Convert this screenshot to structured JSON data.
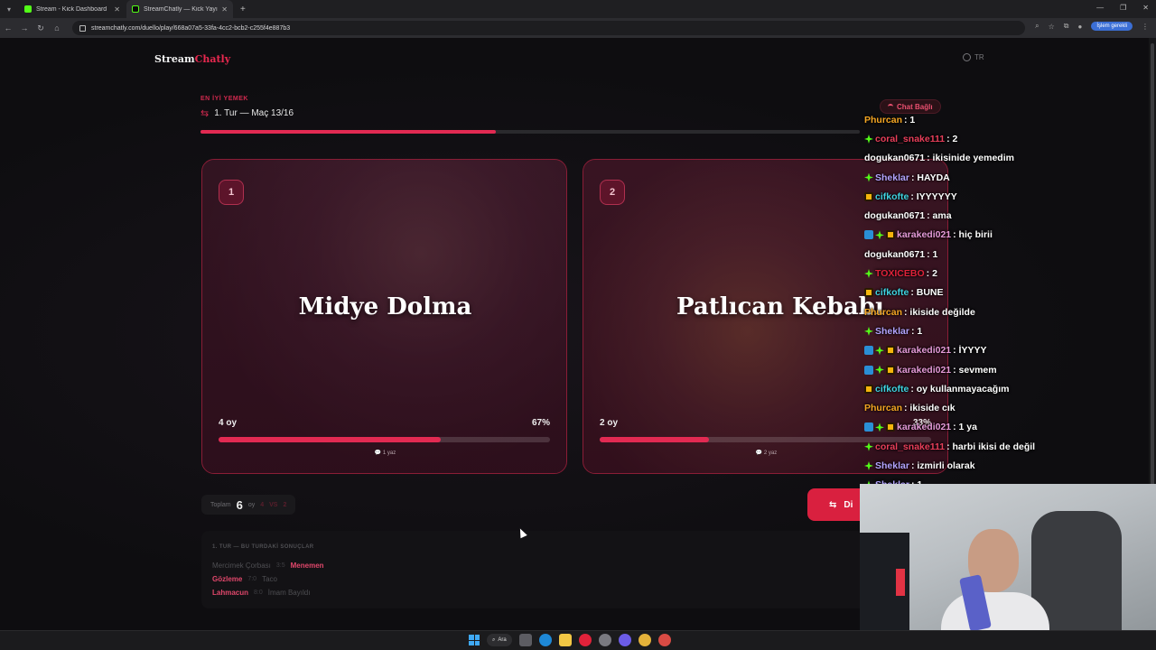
{
  "browser": {
    "tabs": [
      {
        "title": "Stream - Kick Dashboard",
        "active": false
      },
      {
        "title": "StreamChatly — Kick Yayıncıla",
        "active": true
      }
    ],
    "url": "streamchatly.com/duello/play/668a07a5-33fa-4cc2-bcb2-c255f4e887b3",
    "profile_label": "İşlem gerekli"
  },
  "app": {
    "logo_main": "Stream",
    "logo_accent": "Chatly",
    "lang": "TR"
  },
  "duel": {
    "category": "EN İYİ YEMEK",
    "round_label": "1. Tur — Maç 13/16",
    "progress": 0.448,
    "option1": {
      "badge": "1",
      "name": "Midye Dolma",
      "votes": "4 oy",
      "percent": "67%",
      "fill": 0.67,
      "hint": "1 yaz"
    },
    "option2": {
      "badge": "2",
      "name": "Patlıcan Kebabı",
      "votes": "2 oy",
      "percent": "33%",
      "fill": 0.33,
      "hint": "2 yaz"
    },
    "total_label": "Toplam",
    "total_votes": "6",
    "total_unit": "oy",
    "score_left": "4",
    "vs_label": "VS",
    "score_right": "2",
    "next_label": "Di"
  },
  "results": {
    "heading": "1. TUR — BU TURDAKİ SONUÇLAR",
    "rows": [
      {
        "loser": "Mercimek Çorbası",
        "score": "3:5",
        "winner": "Menemen",
        "winner_first": false
      },
      {
        "winner": "Gözleme",
        "score": "7:0",
        "loser": "Taco",
        "winner_first": true
      },
      {
        "winner": "Lahmacun",
        "score": "8:0",
        "loser": "İmam Bayıldı",
        "winner_first": true
      }
    ]
  },
  "chat": {
    "status": "Chat Bağlı",
    "messages": [
      {
        "user": "Phurcan",
        "color": "#f5a623",
        "badges": [],
        "text": ": 1"
      },
      {
        "user": "coral_snake111",
        "color": "#e83e5a",
        "badges": [
          "g"
        ],
        "text": ": 2"
      },
      {
        "user": "dogukan0671",
        "color": "#ffffff",
        "badges": [],
        "text": ": ikisinide yemedim"
      },
      {
        "user": "Sheklar",
        "color": "#b4a4ff",
        "badges": [
          "g"
        ],
        "text": ": HAYDA"
      },
      {
        "user": "cifkofte",
        "color": "#3fd3e0",
        "badges": [
          "y"
        ],
        "text": ": IYYYYYY"
      },
      {
        "user": "dogukan0671",
        "color": "#ffffff",
        "badges": [],
        "text": ": ama"
      },
      {
        "user": "karakedi021",
        "color": "#e59ad8",
        "badges": [
          "b",
          "g",
          "y"
        ],
        "text": ": hiç birii"
      },
      {
        "user": "dogukan0671",
        "color": "#ffffff",
        "badges": [],
        "text": ": 1"
      },
      {
        "user": "TOXICEBO",
        "color": "#e0223a",
        "badges": [
          "g"
        ],
        "text": ": 2"
      },
      {
        "user": "cifkofte",
        "color": "#3fd3e0",
        "badges": [
          "y"
        ],
        "text": ": BUNE"
      },
      {
        "user": "Phurcan",
        "color": "#f5a623",
        "badges": [],
        "text": ": ikiside değilde"
      },
      {
        "user": "Sheklar",
        "color": "#b4a4ff",
        "badges": [
          "g"
        ],
        "text": ": 1"
      },
      {
        "user": "karakedi021",
        "color": "#e59ad8",
        "badges": [
          "b",
          "g",
          "y"
        ],
        "text": ": İYYYY"
      },
      {
        "user": "karakedi021",
        "color": "#e59ad8",
        "badges": [
          "b",
          "g",
          "y"
        ],
        "text": ": sevmem"
      },
      {
        "user": "cifkofte",
        "color": "#3fd3e0",
        "badges": [
          "y"
        ],
        "text": ": oy kullanmayacağım"
      },
      {
        "user": "Phurcan",
        "color": "#f5a623",
        "badges": [],
        "text": ": ikiside cık"
      },
      {
        "user": "karakedi021",
        "color": "#e59ad8",
        "badges": [
          "b",
          "g",
          "y"
        ],
        "text": ": 1 ya"
      },
      {
        "user": "coral_snake111",
        "color": "#e83e5a",
        "badges": [
          "g"
        ],
        "text": ": harbi ikisi de değil"
      },
      {
        "user": "Sheklar",
        "color": "#b4a4ff",
        "badges": [
          "g"
        ],
        "text": ": izmirli olarak"
      },
      {
        "user": "Sheklar",
        "color": "#b4a4ff",
        "badges": [
          "g"
        ],
        "text": ": 1"
      }
    ]
  },
  "taskbar": {
    "search_label": "Ara"
  }
}
